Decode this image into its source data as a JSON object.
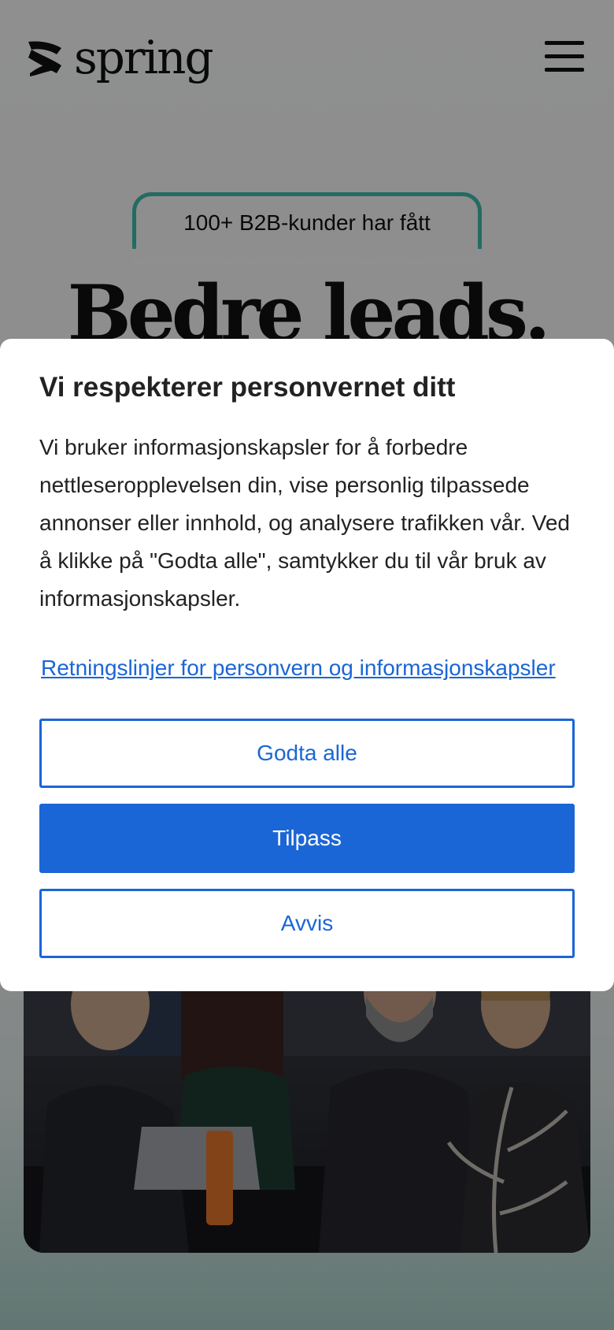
{
  "header": {
    "logo_text": "spring",
    "menu_icon": "hamburger-menu-icon"
  },
  "hero": {
    "badge_text": "100+ B2B-kunder har fått",
    "title": "Bedre leads."
  },
  "cookie_dialog": {
    "title": "Vi respekterer personvernet ditt",
    "body_lines": [
      "Vi bruker informasjonskapsler for å forbedre nettleseropplevelsen din, vise personlig tilpassede annonser eller innhold, og analysere trafikken vår. Ved å klikke på \"Godta alle\", samtykker du til vår bruk av",
      "informasjonskapsler."
    ],
    "policy_link": "Retningslinjer for personvern og informasjonskapsler",
    "accept_label": "Godta alle",
    "customize_label": "Tilpass",
    "reject_label": "Avvis"
  },
  "colors": {
    "accent": "#1a66d6",
    "badge_border": "#3fb8a8",
    "overlay": "rgba(0,0,0,0.42)"
  }
}
